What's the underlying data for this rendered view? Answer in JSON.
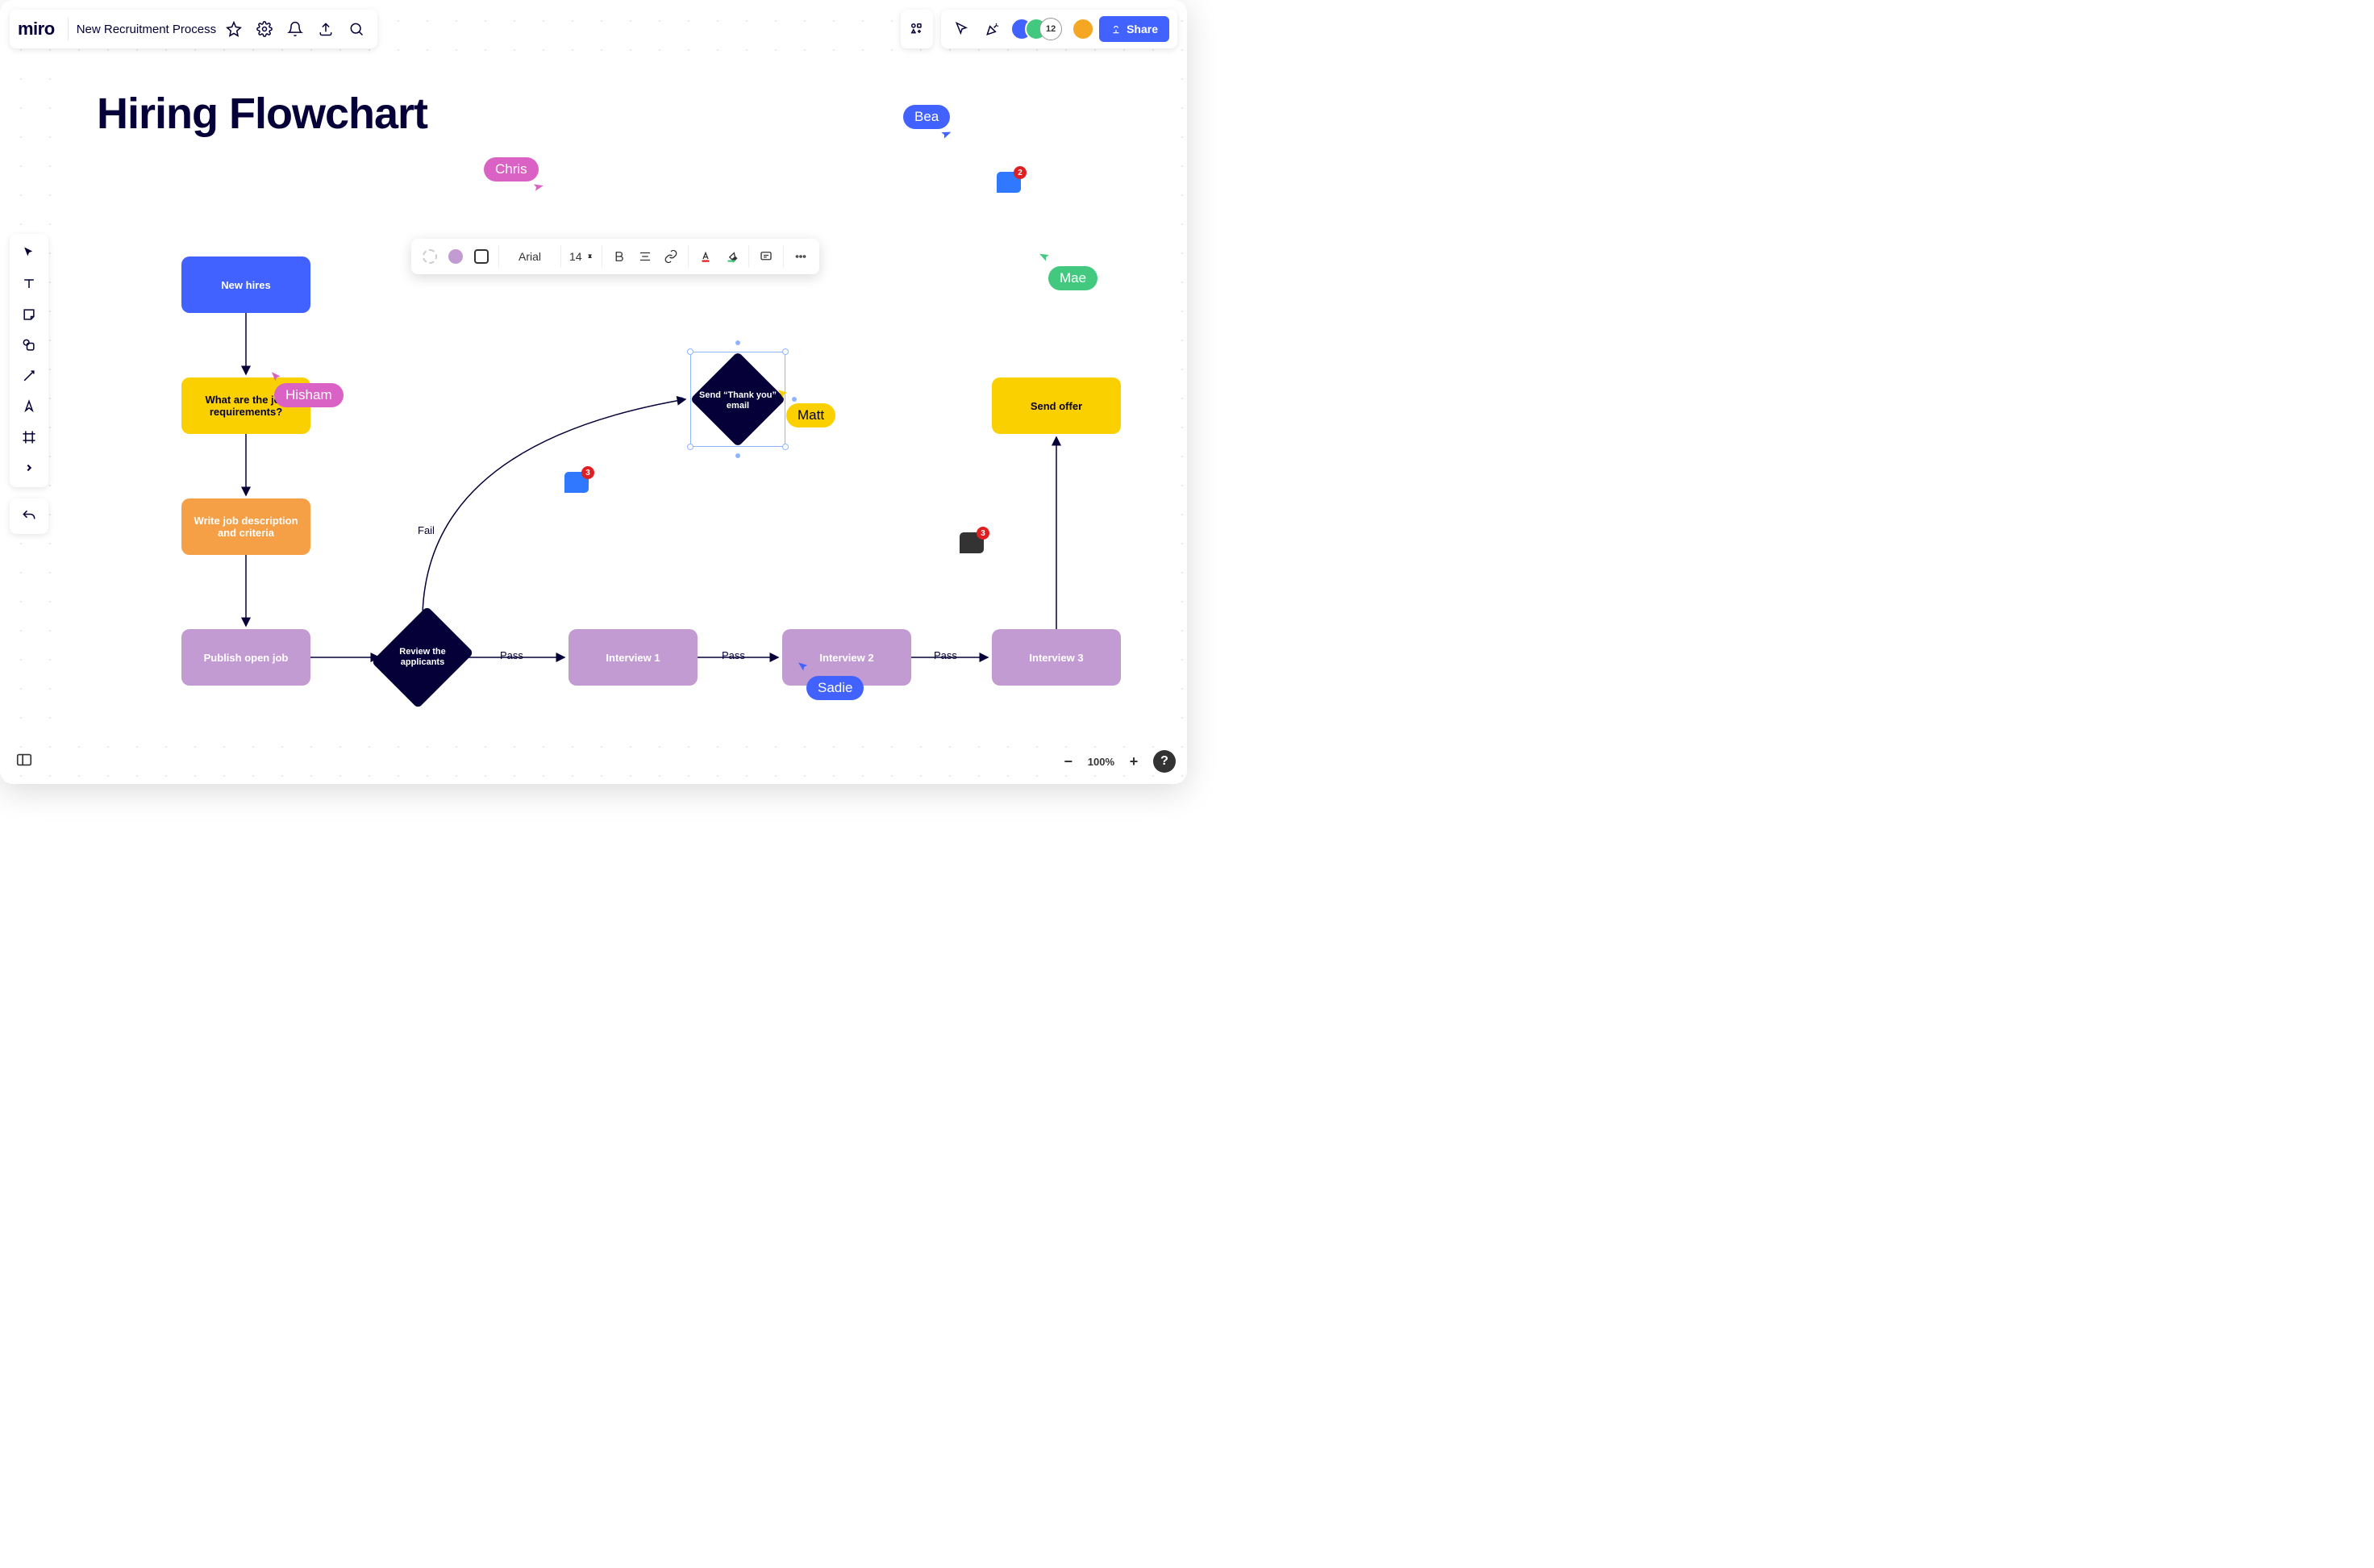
{
  "app": {
    "name": "miro"
  },
  "board": {
    "name": "New Recruitment Process"
  },
  "share_label": "Share",
  "collaborator_count": "12",
  "zoom": {
    "level": "100%"
  },
  "frame": {
    "title": "Hiring Flowchart"
  },
  "toolbar": {
    "font_family": "Arial",
    "font_size": "14"
  },
  "nodes": {
    "new_hires": "New hires",
    "requirements": "What are the job requirements?",
    "write_desc": "Write job description and criteria",
    "publish": "Publish open job",
    "review": "Review the applicants",
    "thankyou": "Send “Thank you” email",
    "interview1": "Interview 1",
    "interview2": "Interview 2",
    "interview3": "Interview 3",
    "send_offer": "Send offer"
  },
  "edges": {
    "fail": "Fail",
    "pass1": "Pass",
    "pass2": "Pass",
    "pass3": "Pass"
  },
  "cursors": {
    "hisham": "Hisham",
    "chris": "Chris",
    "bea": "Bea",
    "mae": "Mae",
    "matt": "Matt",
    "sadie": "Sadie"
  },
  "comments": {
    "c1": "3",
    "c2": "2",
    "c3": "3"
  }
}
